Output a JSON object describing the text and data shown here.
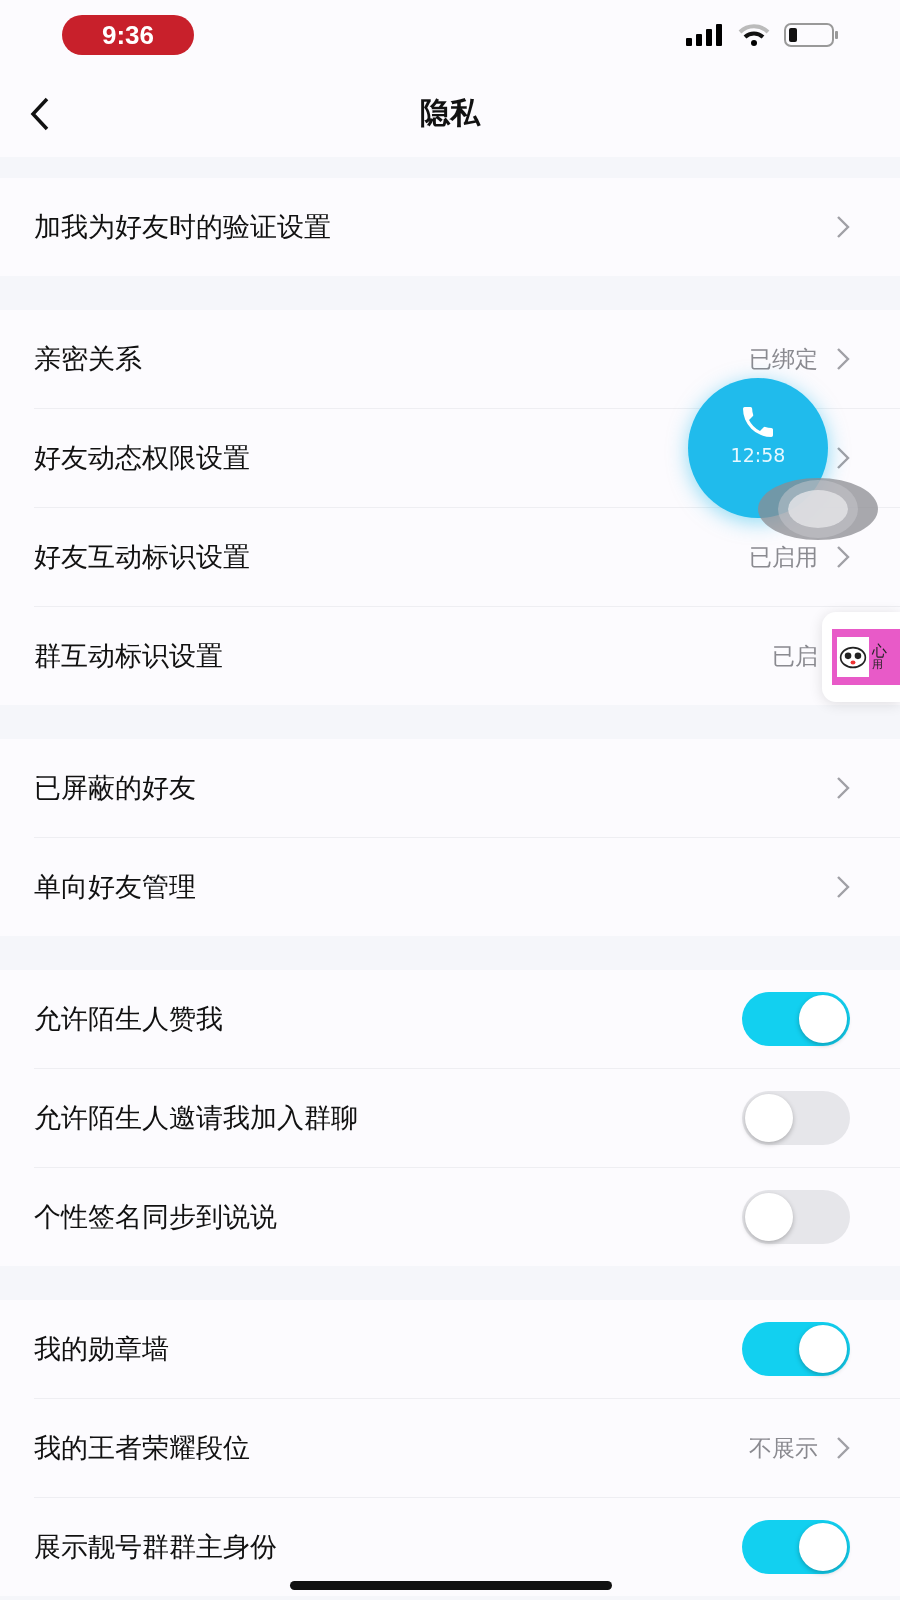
{
  "status_bar": {
    "time": "9:36"
  },
  "nav": {
    "title": "隐私"
  },
  "sections": [
    {
      "rows": [
        {
          "kind": "link",
          "label": "加我为好友时的验证设置",
          "chevron": true
        }
      ]
    },
    {
      "rows": [
        {
          "kind": "link",
          "label": "亲密关系",
          "value": "已绑定",
          "chevron": true
        },
        {
          "kind": "link",
          "label": "好友动态权限设置",
          "chevron": true
        },
        {
          "kind": "link",
          "label": "好友互动标识设置",
          "value": "已启用",
          "chevron": true
        },
        {
          "kind": "link",
          "label": "群互动标识设置",
          "value": "已启",
          "chevron": false
        }
      ]
    },
    {
      "rows": [
        {
          "kind": "link",
          "label": "已屏蔽的好友",
          "chevron": true
        },
        {
          "kind": "link",
          "label": "单向好友管理",
          "chevron": true
        }
      ]
    },
    {
      "rows": [
        {
          "kind": "toggle",
          "label": "允许陌生人赞我",
          "on": true
        },
        {
          "kind": "toggle",
          "label": "允许陌生人邀请我加入群聊",
          "on": false
        },
        {
          "kind": "toggle",
          "label": "个性签名同步到说说",
          "on": false
        }
      ]
    },
    {
      "rows": [
        {
          "kind": "toggle",
          "label": "我的勋章墙",
          "on": true
        },
        {
          "kind": "link",
          "label": "我的王者荣耀段位",
          "value": "不展示",
          "chevron": true
        },
        {
          "kind": "toggle",
          "label": "展示靓号群群主身份",
          "on": true
        }
      ]
    }
  ],
  "call_bubble": {
    "time": "12:58"
  },
  "popup_card": {
    "title": "心",
    "subtitle": "用"
  }
}
